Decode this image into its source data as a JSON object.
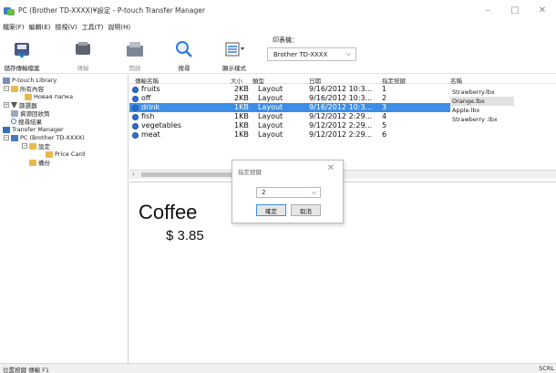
{
  "window": {
    "title": "PC (Brother TD-XXXX)¥設定 - P-touch Transfer Manager",
    "minimize": "–",
    "maximize": "□",
    "close": "✕"
  },
  "menu": [
    "檔案(F)",
    "編輯(E)",
    "檢視(V)",
    "工具(T)",
    "說明(H)"
  ],
  "toolbar": {
    "buttons": [
      {
        "label": "儲存傳輸檔案",
        "enabled": true,
        "icon": "save-transfer-file-icon"
      },
      {
        "label": "傳輸",
        "enabled": false,
        "icon": "transfer-icon"
      },
      {
        "label": "開啟",
        "enabled": false,
        "icon": "open-icon"
      },
      {
        "label": "搜尋",
        "enabled": true,
        "icon": "search-icon"
      },
      {
        "label": "顯示樣式",
        "enabled": true,
        "icon": "display-style-icon"
      }
    ],
    "printer_label": "印表機：",
    "printer_value": "Brother TD-XXXX"
  },
  "tree": [
    {
      "label": "P-touch Library",
      "icon": "library-icon"
    },
    {
      "label": "所有內容",
      "icon": "folder-icon"
    },
    {
      "label": "Новая папка",
      "icon": "folder-icon"
    },
    {
      "label": "篩選器",
      "icon": "filter-icon"
    },
    {
      "label": "資源回收筒",
      "icon": "recycle-bin-icon"
    },
    {
      "label": "搜尋結果",
      "icon": "search-icon"
    },
    {
      "label": "Transfer Manager",
      "icon": "transfer-manager-icon"
    },
    {
      "label": "PC (Brother TD-XXXX)",
      "icon": "pc-icon"
    },
    {
      "label": "設定",
      "icon": "settings-folder-icon"
    },
    {
      "label": "Price Card",
      "icon": "folder-icon"
    },
    {
      "label": "備份",
      "icon": "backup-icon"
    }
  ],
  "table": {
    "headers": [
      "傳輸名稱",
      "大小",
      "類型",
      "日期",
      "指定按鍵",
      "名稱"
    ],
    "rows": [
      {
        "name": "fruits",
        "size": "2KB",
        "type": "Layout",
        "date": "9/16/2012 10:3...",
        "key": "1"
      },
      {
        "name": "off",
        "size": "2KB",
        "type": "Layout",
        "date": "9/16/2012 10:3...",
        "key": "2"
      },
      {
        "name": "drink",
        "size": "1KB",
        "type": "Layout",
        "date": "9/16/2012 10:3...",
        "key": "3"
      },
      {
        "name": "fish",
        "size": "1KB",
        "type": "Layout",
        "date": "9/12/2012 2:29...",
        "key": "4"
      },
      {
        "name": "vegetables",
        "size": "1KB",
        "type": "Layout",
        "date": "9/12/2012 2:29...",
        "key": "5"
      },
      {
        "name": "meat",
        "size": "1KB",
        "type": "Layout",
        "date": "9/12/2012 2:29...",
        "key": "6"
      }
    ],
    "names": [
      "Strawberry.lbx",
      "Orange.lbx",
      "Apple.lbx",
      "Strawberry .lbx"
    ],
    "selected_row": 2,
    "selected_name": 1
  },
  "preview": {
    "title": "Coffee",
    "price": "$ 3.85"
  },
  "dialog": {
    "title": "指定按鍵",
    "close": "✕",
    "select_value": "2",
    "ok": "確定",
    "cancel": "取消"
  },
  "status": {
    "left": "位置按鍵  傳輸 F1",
    "right": "SCRL"
  },
  "colors": {
    "selection": "#3c8ee6",
    "name_selection": "#e1e1e1"
  }
}
